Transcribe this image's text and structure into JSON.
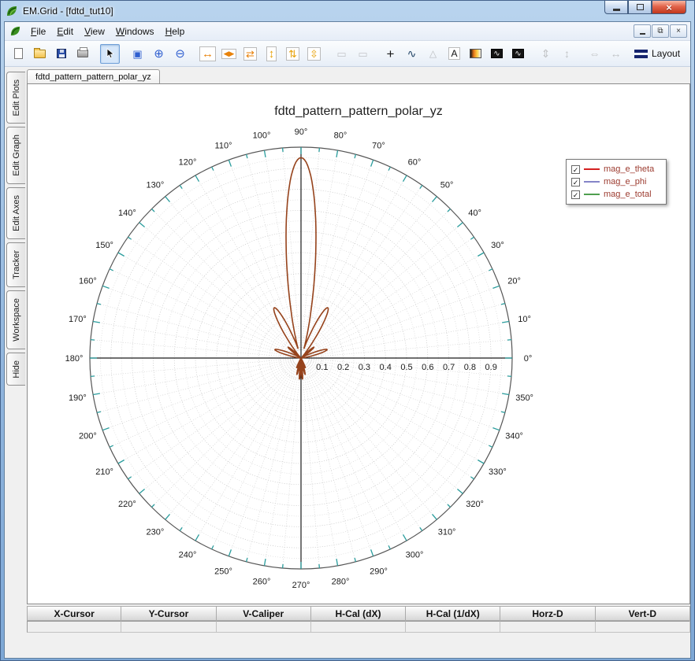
{
  "window": {
    "title": "EM.Grid - [fdtd_tut10]",
    "controls": [
      "minimize-button",
      "maximize-button",
      "close-button"
    ]
  },
  "menu": {
    "items": [
      "File",
      "Edit",
      "View",
      "Windows",
      "Help"
    ],
    "mdi_controls": [
      "child-minimize-button",
      "child-restore-button",
      "child-close-button"
    ]
  },
  "toolbar": {
    "layout_label": "Layout",
    "buttons": [
      {
        "name": "new-document"
      },
      {
        "name": "open-file"
      },
      {
        "name": "save"
      },
      {
        "name": "print"
      },
      {
        "name": "select-pointer",
        "sep": true,
        "pressed": true
      },
      {
        "name": "zoom-window",
        "sep": true
      },
      {
        "name": "zoom-in"
      },
      {
        "name": "zoom-out"
      },
      {
        "name": "expand-horizontal",
        "sep": true
      },
      {
        "name": "split-horizontal"
      },
      {
        "name": "center-horizontal"
      },
      {
        "name": "expand-vertical"
      },
      {
        "name": "split-vertical"
      },
      {
        "name": "center-vertical"
      },
      {
        "name": "frame-outline",
        "sep": true,
        "disabled": true
      },
      {
        "name": "frame-filled",
        "disabled": true
      },
      {
        "name": "crosshair",
        "sep": true
      },
      {
        "name": "curve-tracker"
      },
      {
        "name": "polygon",
        "disabled": true
      },
      {
        "name": "text-annotation"
      },
      {
        "name": "colormap"
      },
      {
        "name": "wave-black-1"
      },
      {
        "name": "wave-black-2"
      },
      {
        "name": "pan-vertical",
        "sep": true,
        "disabled": true
      },
      {
        "name": "fit-vertical",
        "disabled": true
      },
      {
        "name": "pan-horizontal",
        "sep": true,
        "disabled": true
      },
      {
        "name": "fit-horizontal",
        "disabled": true
      }
    ]
  },
  "sidebar": {
    "tabs": [
      "Edit Plots",
      "Edit Graph",
      "Edit Axes",
      "Tracker",
      "Workspace",
      "Hide"
    ]
  },
  "document": {
    "tab_label": "fdtd_pattern_pattern_polar_yz"
  },
  "chart_data": {
    "type": "polar-line",
    "title": "fdtd_pattern_pattern_polar_yz",
    "r_max": 1.0,
    "ring_step": 0.05,
    "spoke_step_deg": 5,
    "angle_label_step_deg": 10,
    "angle_labels": [
      "0°",
      "10°",
      "20°",
      "30°",
      "40°",
      "50°",
      "60°",
      "70°",
      "80°",
      "90°",
      "100°",
      "110°",
      "120°",
      "130°",
      "140°",
      "150°",
      "160°",
      "170°",
      "180°",
      "190°",
      "200°",
      "210°",
      "220°",
      "230°",
      "240°",
      "250°",
      "260°",
      "270°",
      "280°",
      "290°",
      "300°",
      "310°",
      "320°",
      "330°",
      "340°",
      "350°"
    ],
    "radial_labels": [
      "0.1",
      "0.2",
      "0.3",
      "0.4",
      "0.5",
      "0.6",
      "0.7",
      "0.8",
      "0.9"
    ],
    "colors": {
      "grid": "#d0d0d0",
      "axis": "#1a1a1a",
      "tick": "#2a9d9d",
      "outer": "#555555",
      "curve": "#96431c"
    },
    "series": [
      {
        "name": "mag_e_theta",
        "color": "#d42020",
        "visible": true
      },
      {
        "name": "mag_e_phi",
        "color": "#8585c8",
        "visible": true
      },
      {
        "name": "mag_e_total",
        "color": "#4f9f4f",
        "visible": true
      }
    ],
    "pattern_lobes": [
      {
        "center_deg": 90,
        "peak_r": 0.95,
        "width_deg": 10
      },
      {
        "center_deg": 62,
        "peak_r": 0.27,
        "width_deg": 8
      },
      {
        "center_deg": 118,
        "peak_r": 0.27,
        "width_deg": 8
      },
      {
        "center_deg": 40,
        "peak_r": 0.08,
        "width_deg": 5
      },
      {
        "center_deg": 140,
        "peak_r": 0.08,
        "width_deg": 5
      },
      {
        "center_deg": 18,
        "peak_r": 0.13,
        "width_deg": 7
      },
      {
        "center_deg": 162,
        "peak_r": 0.13,
        "width_deg": 7
      },
      {
        "center_deg": 246,
        "peak_r": 0.05,
        "width_deg": 3.5
      },
      {
        "center_deg": 256,
        "peak_r": 0.08,
        "width_deg": 3.5
      },
      {
        "center_deg": 266,
        "peak_r": 0.1,
        "width_deg": 3.5
      },
      {
        "center_deg": 274,
        "peak_r": 0.1,
        "width_deg": 3.5
      },
      {
        "center_deg": 284,
        "peak_r": 0.08,
        "width_deg": 3.5
      },
      {
        "center_deg": 294,
        "peak_r": 0.05,
        "width_deg": 3.5
      }
    ]
  },
  "legend": {
    "label_color": "#9c3b2f",
    "items": [
      {
        "label": "mag_e_theta",
        "color": "#d42020",
        "checked": true
      },
      {
        "label": "mag_e_phi",
        "color": "#8585c8",
        "checked": true
      },
      {
        "label": "mag_e_total",
        "color": "#4f9f4f",
        "checked": true
      }
    ]
  },
  "cursor_table": {
    "headers": [
      "X-Cursor",
      "Y-Cursor",
      "V-Caliper",
      "H-Cal (dX)",
      "H-Cal (1/dX)",
      "Horz-D",
      "Vert-D"
    ],
    "values": [
      "",
      "",
      "",
      "",
      "",
      "",
      ""
    ]
  }
}
